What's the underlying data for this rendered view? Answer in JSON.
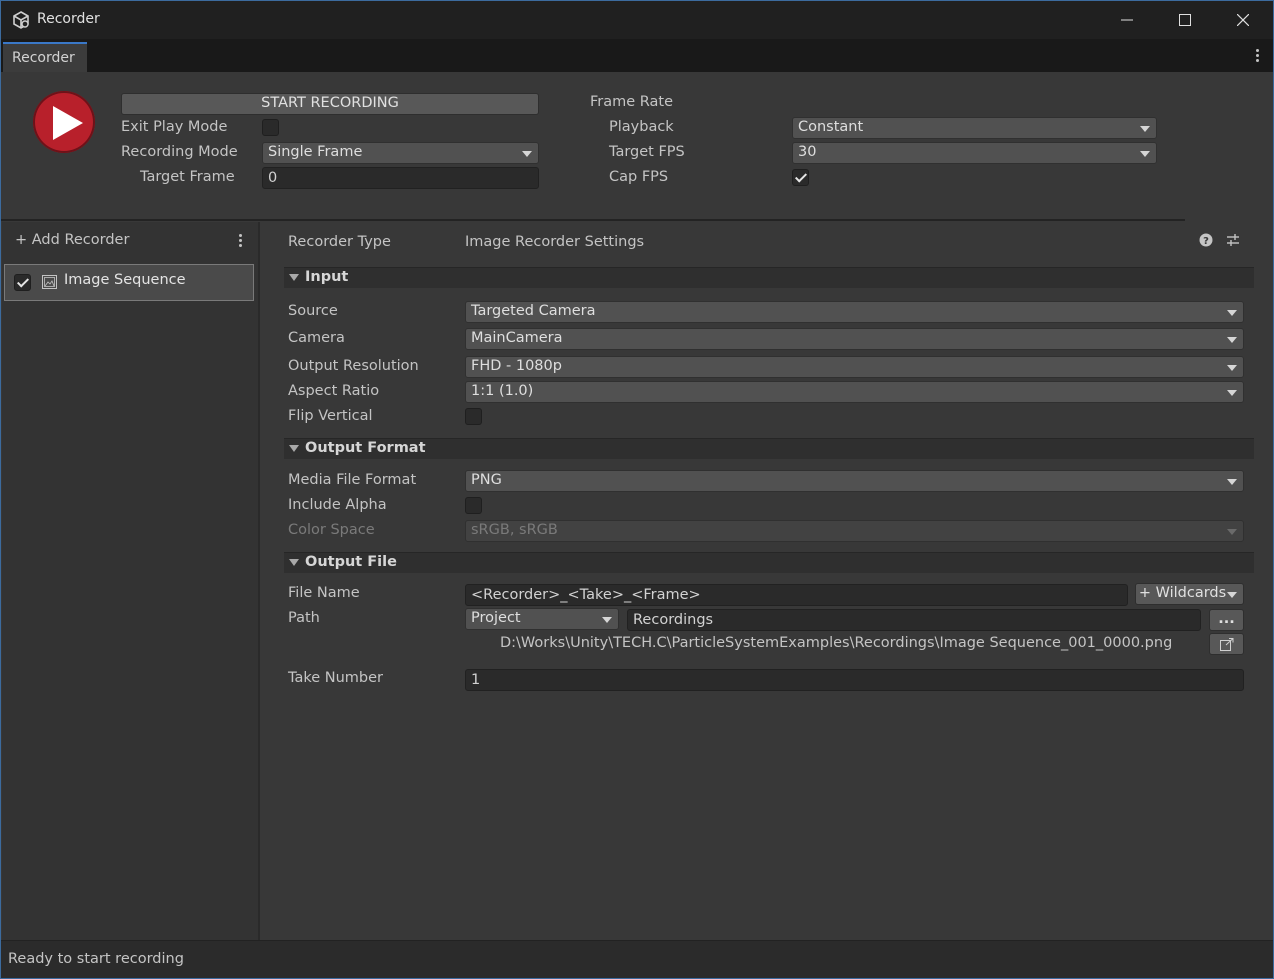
{
  "window": {
    "title": "Recorder"
  },
  "tab": {
    "label": "Recorder"
  },
  "top": {
    "start_label": "START RECORDING",
    "exit_play_mode_label": "Exit Play Mode",
    "exit_play_mode_checked": false,
    "recording_mode_label": "Recording Mode",
    "recording_mode_value": "Single Frame",
    "target_frame_label": "Target Frame",
    "target_frame_value": "0",
    "frame_rate_label": "Frame Rate",
    "playback_label": "Playback",
    "playback_value": "Constant",
    "target_fps_label": "Target FPS",
    "target_fps_value": "30",
    "cap_fps_label": "Cap FPS",
    "cap_fps_checked": true
  },
  "left": {
    "add_recorder_label": "+ Add Recorder",
    "recorders": [
      {
        "label": "Image Sequence",
        "enabled": true
      }
    ]
  },
  "settings": {
    "recorder_type_label": "Recorder Type",
    "recorder_type_value": "Image Recorder Settings",
    "input": {
      "title": "Input",
      "source_label": "Source",
      "source_value": "Targeted Camera",
      "camera_label": "Camera",
      "camera_value": "MainCamera",
      "resolution_label": "Output Resolution",
      "resolution_value": "FHD - 1080p",
      "aspect_label": "Aspect Ratio",
      "aspect_value": "1:1 (1.0)",
      "flip_label": "Flip Vertical",
      "flip_checked": false
    },
    "output_format": {
      "title": "Output Format",
      "media_label": "Media File Format",
      "media_value": "PNG",
      "alpha_label": "Include Alpha",
      "alpha_checked": false,
      "color_space_label": "Color Space",
      "color_space_value": "sRGB, sRGB"
    },
    "output_file": {
      "title": "Output File",
      "file_name_label": "File Name",
      "file_name_value": "<Recorder>_<Take>_<Frame>",
      "wildcards_label": "+ Wildcards",
      "path_label": "Path",
      "path_root_value": "Project",
      "path_value": "Recordings",
      "browse_label": "...",
      "full_path": "D:\\Works\\Unity\\TECH.C\\ParticleSystemExamples\\Recordings\\Image Sequence_001_0000.png",
      "take_number_label": "Take Number",
      "take_number_value": "1"
    }
  },
  "status": {
    "text": "Ready to start recording"
  }
}
